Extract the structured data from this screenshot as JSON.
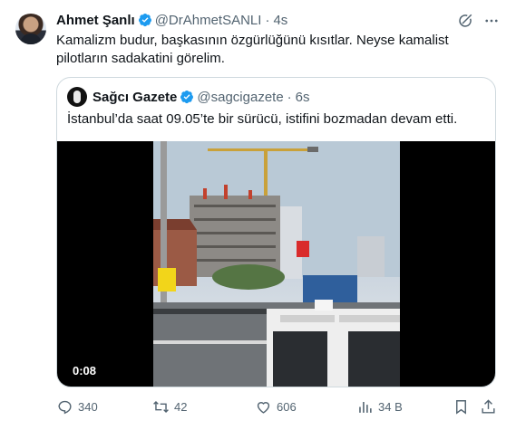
{
  "author": {
    "name": "Ahmet Şanlı",
    "handle": "@DrAhmetSANLI",
    "separator": "·",
    "time": "4s"
  },
  "tweet_text": "Kamalizm budur, başkasının özgürlüğünü kısıtlar. Neyse kamalist pilotların sadakatini görelim.",
  "quoted": {
    "name": "Sağcı Gazete",
    "handle": "@sagcigazete",
    "separator": "·",
    "time": "6s",
    "text": "İstanbul’da saat 09.05’te bir sürücü, istifini bozmadan devam etti.",
    "video_duration": "0:08"
  },
  "actions": {
    "replies": "340",
    "retweets": "42",
    "likes": "606",
    "views": "34 B"
  },
  "colors": {
    "verified": "#1d9bf0",
    "secondary_text": "#536471",
    "border": "#cfd9de"
  },
  "icons": [
    "verified-badge-icon",
    "grok-icon",
    "more-icon",
    "reply-icon",
    "retweet-icon",
    "like-icon",
    "views-icon",
    "bookmark-icon",
    "share-icon"
  ]
}
